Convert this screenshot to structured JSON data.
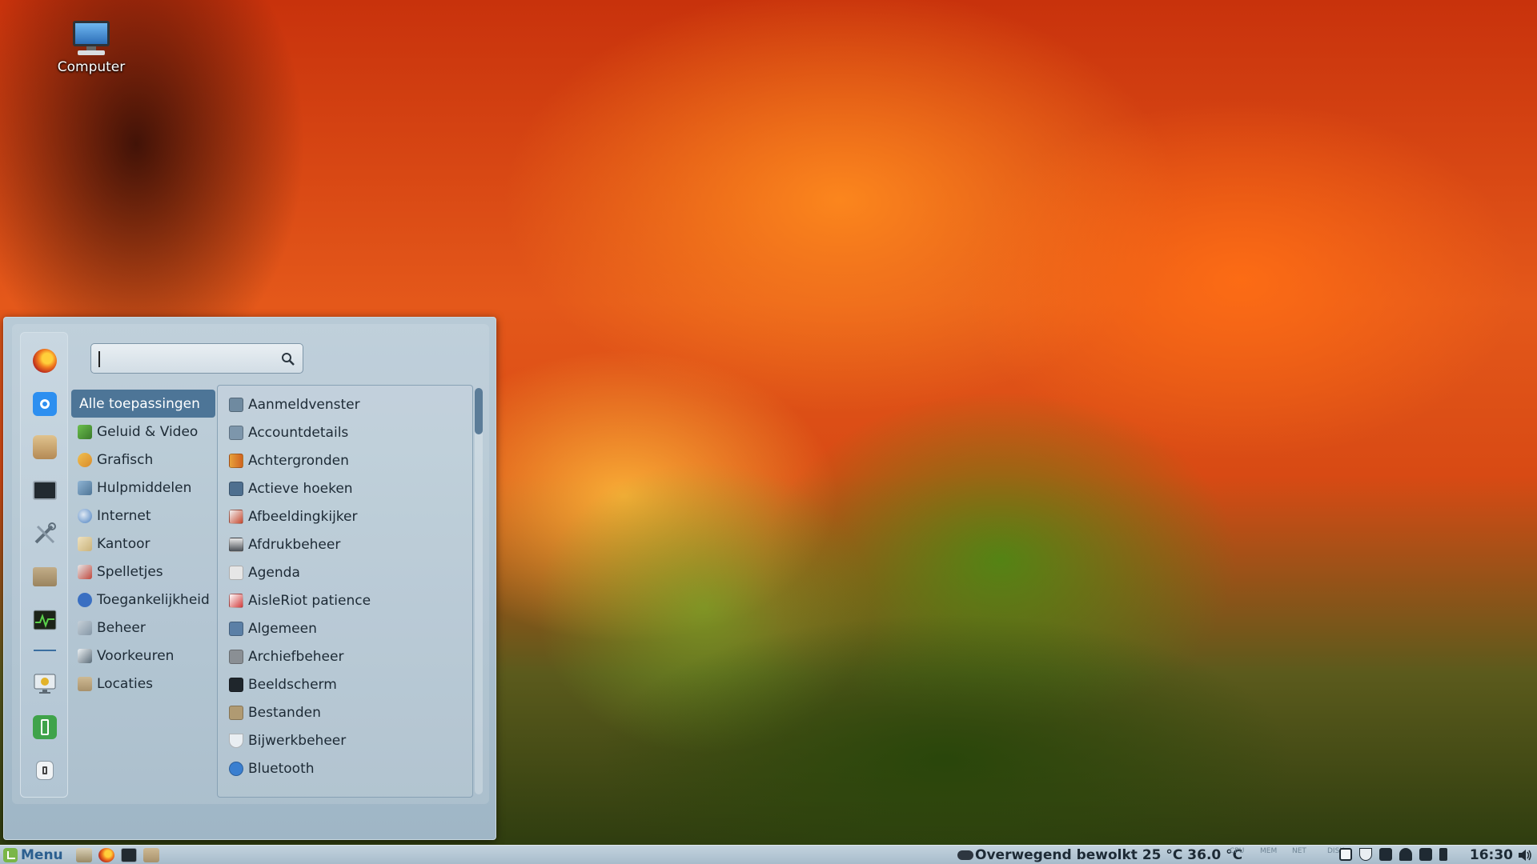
{
  "desktop": {
    "icons": [
      {
        "label": "Computer",
        "icon": "computer-icon"
      }
    ]
  },
  "menu": {
    "search": {
      "placeholder": "",
      "value": ""
    },
    "favorites": [
      {
        "name": "firefox-icon",
        "color": "#e8602a"
      },
      {
        "name": "screenshot-icon",
        "color": "#2d8ff0"
      },
      {
        "name": "archive-manager-icon",
        "color": "#c9a46a"
      },
      {
        "name": "terminal-icon",
        "color": "#222a30"
      },
      {
        "name": "tools-icon",
        "color": "#8fa3b3"
      },
      {
        "name": "files-icon",
        "color": "#a89578"
      },
      {
        "name": "system-monitor-icon",
        "color": "#1f2a1a"
      },
      {
        "name": "lock-screen-icon",
        "color": "#b7c4cc"
      },
      {
        "name": "logout-icon",
        "color": "#3fa34a"
      },
      {
        "name": "shutdown-icon",
        "color": "#e9eef2"
      }
    ],
    "categories": [
      {
        "label": "Alle toepassingen",
        "selected": true,
        "icon": ""
      },
      {
        "label": "Geluid & Video",
        "icon": "multimedia-icon",
        "color": "#6bbf4e"
      },
      {
        "label": "Grafisch",
        "icon": "graphics-icon",
        "color": "#d98b2b"
      },
      {
        "label": "Hulpmiddelen",
        "icon": "accessories-icon",
        "color": "#6b8fb0"
      },
      {
        "label": "Internet",
        "icon": "internet-icon",
        "color": "#4a7fbf"
      },
      {
        "label": "Kantoor",
        "icon": "office-icon",
        "color": "#c9b27a"
      },
      {
        "label": "Spelletjes",
        "icon": "games-icon",
        "color": "#c0473c"
      },
      {
        "label": "Toegankelijkheid",
        "icon": "accessibility-icon",
        "color": "#3a6fc2"
      },
      {
        "label": "Beheer",
        "icon": "administration-icon",
        "color": "#8597a6"
      },
      {
        "label": "Voorkeuren",
        "icon": "preferences-icon",
        "color": "#5a6b78"
      },
      {
        "label": "Locaties",
        "icon": "places-icon",
        "color": "#a8916b"
      }
    ],
    "apps": [
      {
        "label": "Aanmeldvenster",
        "icon": "login-window-icon",
        "color": "#6f8aa0"
      },
      {
        "label": "Accountdetails",
        "icon": "account-details-icon",
        "color": "#7d96ab"
      },
      {
        "label": "Achtergronden",
        "icon": "backgrounds-icon",
        "color": "#d0631f"
      },
      {
        "label": "Actieve hoeken",
        "icon": "hot-corners-icon",
        "color": "#4e6f8f"
      },
      {
        "label": "Afbeeldingkijker",
        "icon": "image-viewer-icon",
        "color": "#c5482f"
      },
      {
        "label": "Afdrukbeheer",
        "icon": "printers-icon",
        "color": "#4a4f55"
      },
      {
        "label": "Agenda",
        "icon": "calendar-icon",
        "color": "#e6e6e6"
      },
      {
        "label": "AisleRiot patience",
        "icon": "aisleriot-icon",
        "color": "#d13b3b"
      },
      {
        "label": "Algemeen",
        "icon": "general-icon",
        "color": "#5b7fa6"
      },
      {
        "label": "Archiefbeheer",
        "icon": "archive-manager-icon",
        "color": "#8a8f94"
      },
      {
        "label": "Beeldscherm",
        "icon": "display-icon",
        "color": "#1f262c"
      },
      {
        "label": "Bestanden",
        "icon": "files-icon",
        "color": "#b09a72"
      },
      {
        "label": "Bijwerkbeheer",
        "icon": "update-manager-icon",
        "color": "#e9eef2"
      },
      {
        "label": "Bluetooth",
        "icon": "bluetooth-icon",
        "color": "#3a7fd0"
      }
    ]
  },
  "taskbar": {
    "menu_label": "Menu",
    "launchers": [
      "show-desktop-icon",
      "firefox-icon",
      "terminal-icon",
      "files-icon"
    ],
    "weather": "Overwegend bewolkt 25 °C 36.0 °C",
    "monitors": [
      "CPU",
      "MEM",
      "NET",
      "DISK"
    ],
    "tray": [
      "screenshot-tray-icon",
      "update-shield-icon",
      "keyboard-icon",
      "user-icon",
      "network-icon",
      "battery-icon"
    ],
    "clock": "16:30"
  }
}
